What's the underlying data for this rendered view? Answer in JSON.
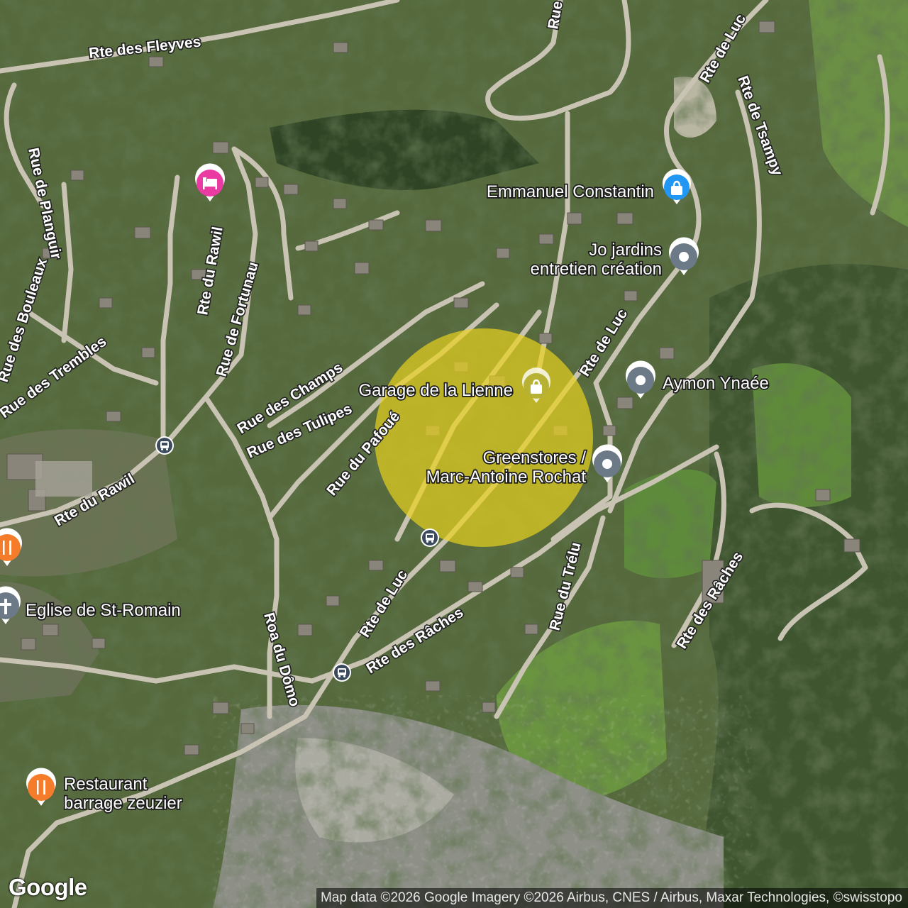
{
  "map": {
    "attribution": "Map data ©2026 Google Imagery ©2026 Airbus, CNES / Airbus, Maxar Technologies, ©swisstopo",
    "logo": "Google",
    "colors": {
      "highlight": "#e8d21e",
      "shopping_marker": "#2196f3",
      "place_marker": "#6c7a87",
      "lodging_marker": "#ea3ba3",
      "food_marker": "#f57c2a",
      "transit_marker": "#3c4a5e"
    }
  },
  "roads": [
    "Rte des Fleyves",
    "Rue",
    "Rte de Luc",
    "Rte de Tsampy",
    "Rue de Planguir",
    "Rue des Bouleaux",
    "Rue des Trembles",
    "Rte du Rawil",
    "Rue de Fortunau",
    "Rue des Champs",
    "Rue des Tulipes",
    "Rue du Pafoué",
    "Rte du Rawil",
    "Rte de Luc",
    "Rue du Trélu",
    "Rte des Râches",
    "Roa du Dômo",
    "Rte de Luc",
    "Rte des Râches"
  ],
  "places": [
    {
      "id": "emmanuel",
      "lines": [
        "Emmanuel Constantin"
      ],
      "icon": "shopping-bag-icon"
    },
    {
      "id": "jo",
      "lines": [
        "Jo jardins",
        "entretien création"
      ],
      "icon": "map-pin-icon"
    },
    {
      "id": "aymon",
      "lines": [
        "Aymon Ynaée"
      ],
      "icon": "map-pin-icon"
    },
    {
      "id": "garage",
      "lines": [
        "Garage de la Lienne"
      ],
      "icon": "shopping-bag-icon"
    },
    {
      "id": "greenstores",
      "lines": [
        "Greenstores /",
        "Marc-Antoine Rochat"
      ],
      "icon": "map-pin-icon"
    },
    {
      "id": "eglise",
      "lines": [
        "Eglise de St-Romain"
      ],
      "icon": "church-icon"
    },
    {
      "id": "restaurant",
      "lines": [
        "Restaurant",
        "barrage zeuzier"
      ],
      "icon": "fork-knife-icon"
    },
    {
      "id": "hotel",
      "lines": [],
      "icon": "bed-icon"
    },
    {
      "id": "food-left",
      "lines": [],
      "icon": "fork-knife-icon"
    },
    {
      "id": "bus-1",
      "lines": [],
      "icon": "bus-icon"
    },
    {
      "id": "bus-2",
      "lines": [],
      "icon": "bus-icon"
    },
    {
      "id": "bus-3",
      "lines": [],
      "icon": "bus-icon"
    }
  ]
}
